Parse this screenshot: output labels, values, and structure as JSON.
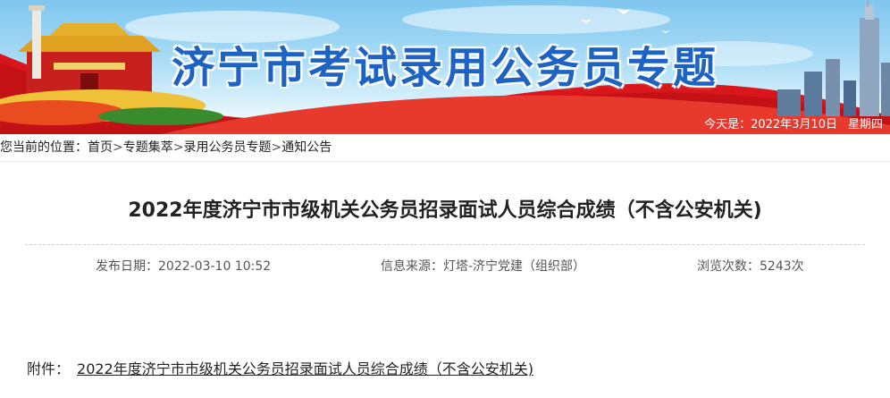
{
  "banner": {
    "title": "济宁市考试录用公务员专题",
    "date_prefix": "今天是：",
    "date": "2022年3月10日",
    "weekday": "星期四"
  },
  "breadcrumb": {
    "prefix": "您当前的位置：",
    "items": [
      "首页",
      "专题集萃",
      "录用公务员专题",
      "通知公告"
    ],
    "separator": ">"
  },
  "article": {
    "title": "2022年度济宁市市级机关公务员招录面试人员综合成绩（不含公安机关)",
    "publish_date": "发布日期：2022-03-10 10:52",
    "source": "信息来源：灯塔-济宁党建（组织部）",
    "views": "浏览次数：5243次",
    "attachment_label": "附件：",
    "attachment_link": "2022年度济宁市市级机关公务员招录面试人员综合成绩（不含公安机关)"
  },
  "colors": {
    "title_blue": "#1d63c4",
    "banner_red": "#d8161b",
    "sky": "#8fd0f2"
  }
}
